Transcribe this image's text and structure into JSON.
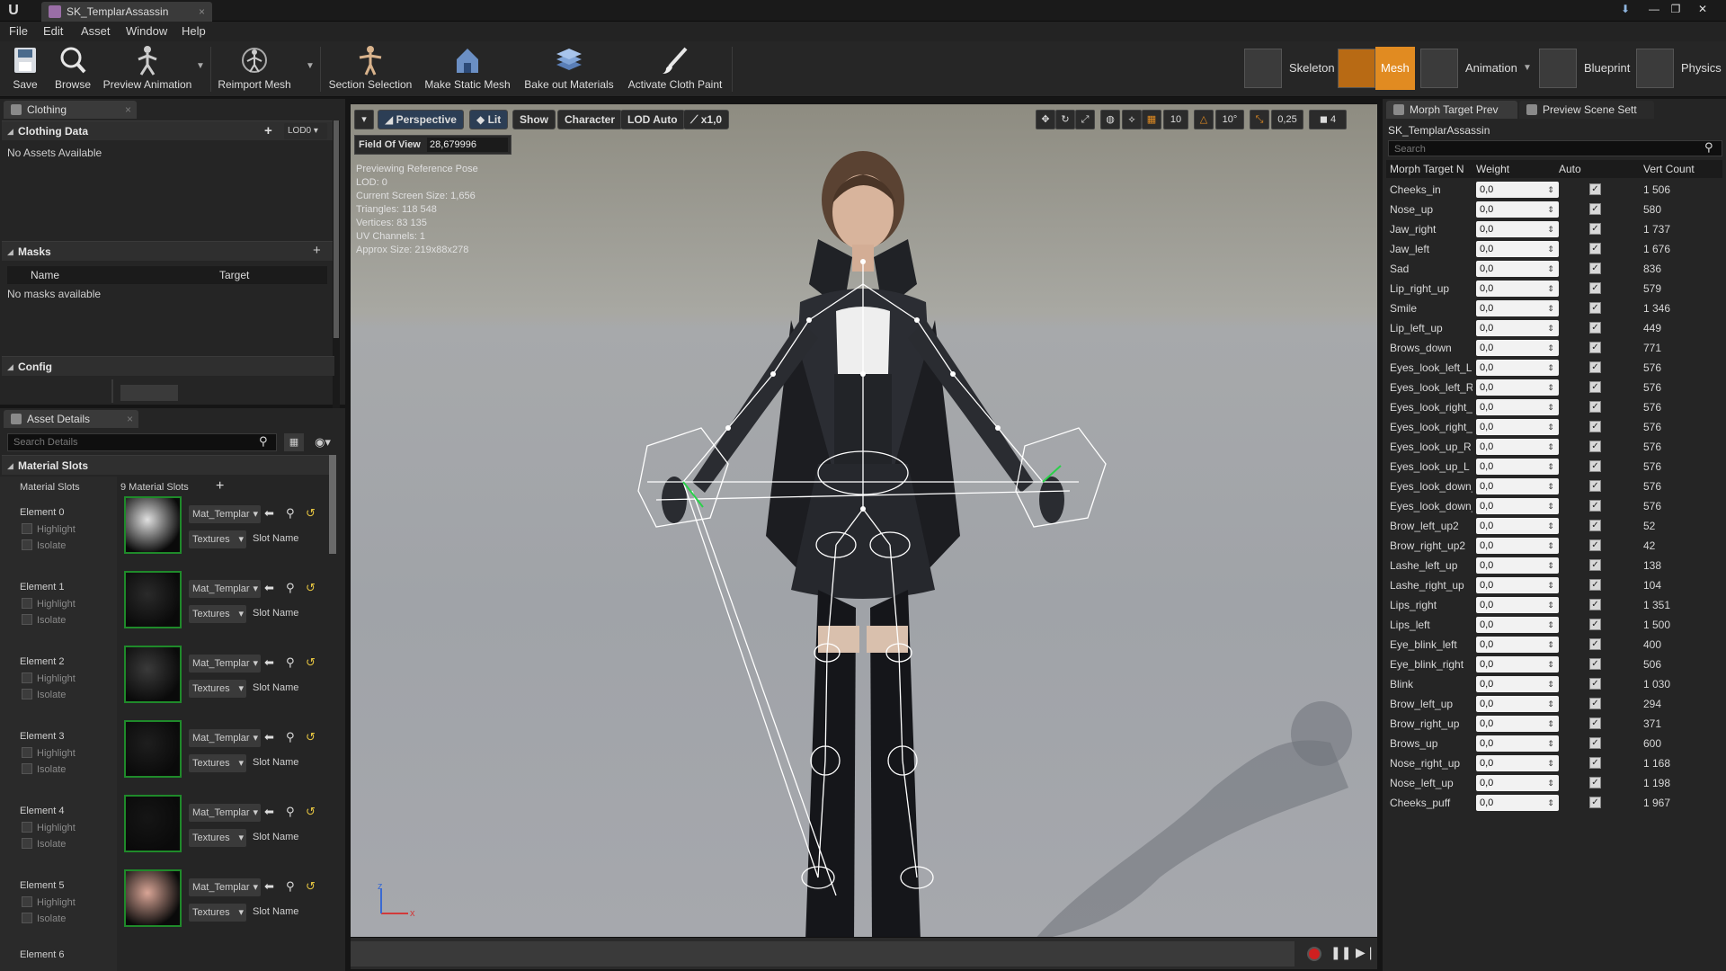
{
  "window": {
    "tab_title": "SK_TemplarAssassin",
    "logo": "U",
    "controls": [
      "—",
      "❐",
      "✕"
    ]
  },
  "menu": [
    "File",
    "Edit",
    "Asset",
    "Window",
    "Help"
  ],
  "toolbar": {
    "save": "Save",
    "browse": "Browse",
    "preview_animation": "Preview Animation",
    "reimport_mesh": "Reimport Mesh",
    "section_selection": "Section Selection",
    "make_static_mesh": "Make Static Mesh",
    "bake_out_materials": "Bake out Materials",
    "activate_cloth_paint": "Activate Cloth Paint"
  },
  "modes": {
    "skeleton": "Skeleton",
    "mesh": "Mesh",
    "animation": "Animation",
    "blueprint": "Blueprint",
    "physics": "Physics",
    "active": "Mesh"
  },
  "clothing": {
    "tab": "Clothing",
    "data_header": "Clothing Data",
    "lod_combo": "LOD0",
    "no_assets": "No Assets Available",
    "masks_header": "Masks",
    "col_name": "Name",
    "col_target": "Target",
    "no_masks": "No masks available",
    "config_header": "Config"
  },
  "asset_details": {
    "tab": "Asset Details",
    "search_placeholder": "Search Details",
    "material_slots_header": "Material Slots",
    "material_slots_label": "Material Slots",
    "slot_count": "9 Material Slots",
    "highlight": "Highlight",
    "isolate": "Isolate",
    "material_name": "Mat_Templar",
    "textures": "Textures",
    "slot_name": "Slot Name",
    "elements": [
      "Element 0",
      "Element 1",
      "Element 2",
      "Element 3",
      "Element 4",
      "Element 5"
    ],
    "element_cut": "Element 6"
  },
  "viewport": {
    "perspective": "Perspective",
    "lit": "Lit",
    "show": "Show",
    "character": "Character",
    "lod_auto": "LOD Auto",
    "speed": "x1,0",
    "fov_label": "Field Of View",
    "fov_value": "28,679996",
    "grid_snap": "10",
    "rot_snap": "10°",
    "scale_snap": "0,25",
    "cam_speed": "4",
    "stats": [
      "Previewing Reference Pose",
      "LOD: 0",
      "Current Screen Size: 1,656",
      "Triangles: 118 548",
      "Vertices: 83 135",
      "UV Channels: 1",
      "Approx Size: 219x88x278"
    ],
    "axis_x": "x",
    "axis_z": "z"
  },
  "right_panel": {
    "tab_morph": "Morph Target Prev",
    "tab_scene": "Preview Scene Sett",
    "asset_name": "SK_TemplarAssassin",
    "search_placeholder": "Search",
    "col_name": "Morph Target N",
    "col_weight": "Weight",
    "col_auto": "Auto",
    "col_vert": "Vert Count",
    "morph_targets": [
      {
        "name": "Cheeks_in",
        "weight": "0,0",
        "verts": "1 506"
      },
      {
        "name": "Nose_up",
        "weight": "0,0",
        "verts": "580"
      },
      {
        "name": "Jaw_right",
        "weight": "0,0",
        "verts": "1 737"
      },
      {
        "name": "Jaw_left",
        "weight": "0,0",
        "verts": "1 676"
      },
      {
        "name": "Sad",
        "weight": "0,0",
        "verts": "836"
      },
      {
        "name": "Lip_right_up",
        "weight": "0,0",
        "verts": "579"
      },
      {
        "name": "Smile",
        "weight": "0,0",
        "verts": "1 346"
      },
      {
        "name": "Lip_left_up",
        "weight": "0,0",
        "verts": "449"
      },
      {
        "name": "Brows_down",
        "weight": "0,0",
        "verts": "771"
      },
      {
        "name": "Eyes_look_left_L",
        "weight": "0,0",
        "verts": "576"
      },
      {
        "name": "Eyes_look_left_R",
        "weight": "0,0",
        "verts": "576"
      },
      {
        "name": "Eyes_look_right_L",
        "weight": "0,0",
        "verts": "576"
      },
      {
        "name": "Eyes_look_right_R",
        "weight": "0,0",
        "verts": "576"
      },
      {
        "name": "Eyes_look_up_R",
        "weight": "0,0",
        "verts": "576"
      },
      {
        "name": "Eyes_look_up_L",
        "weight": "0,0",
        "verts": "576"
      },
      {
        "name": "Eyes_look_down_R",
        "weight": "0,0",
        "verts": "576"
      },
      {
        "name": "Eyes_look_down_L",
        "weight": "0,0",
        "verts": "576"
      },
      {
        "name": "Brow_left_up2",
        "weight": "0,0",
        "verts": "52"
      },
      {
        "name": "Brow_right_up2",
        "weight": "0,0",
        "verts": "42"
      },
      {
        "name": "Lashe_left_up",
        "weight": "0,0",
        "verts": "138"
      },
      {
        "name": "Lashe_right_up",
        "weight": "0,0",
        "verts": "104"
      },
      {
        "name": "Lips_right",
        "weight": "0,0",
        "verts": "1 351"
      },
      {
        "name": "Lips_left",
        "weight": "0,0",
        "verts": "1 500"
      },
      {
        "name": "Eye_blink_left",
        "weight": "0,0",
        "verts": "400"
      },
      {
        "name": "Eye_blink_right",
        "weight": "0,0",
        "verts": "506"
      },
      {
        "name": "Blink",
        "weight": "0,0",
        "verts": "1 030"
      },
      {
        "name": "Brow_left_up",
        "weight": "0,0",
        "verts": "294"
      },
      {
        "name": "Brow_right_up",
        "weight": "0,0",
        "verts": "371"
      },
      {
        "name": "Brows_up",
        "weight": "0,0",
        "verts": "600"
      },
      {
        "name": "Nose_right_up",
        "weight": "0,0",
        "verts": "1 168"
      },
      {
        "name": "Nose_left_up",
        "weight": "0,0",
        "verts": "1 198"
      },
      {
        "name": "Cheeks_puff",
        "weight": "0,0",
        "verts": "1 967"
      }
    ]
  },
  "colors": {
    "accent_orange": "#e18b21",
    "panel_bg": "#252525",
    "selection_green": "#1f8a2a",
    "record_red": "#d02020"
  }
}
